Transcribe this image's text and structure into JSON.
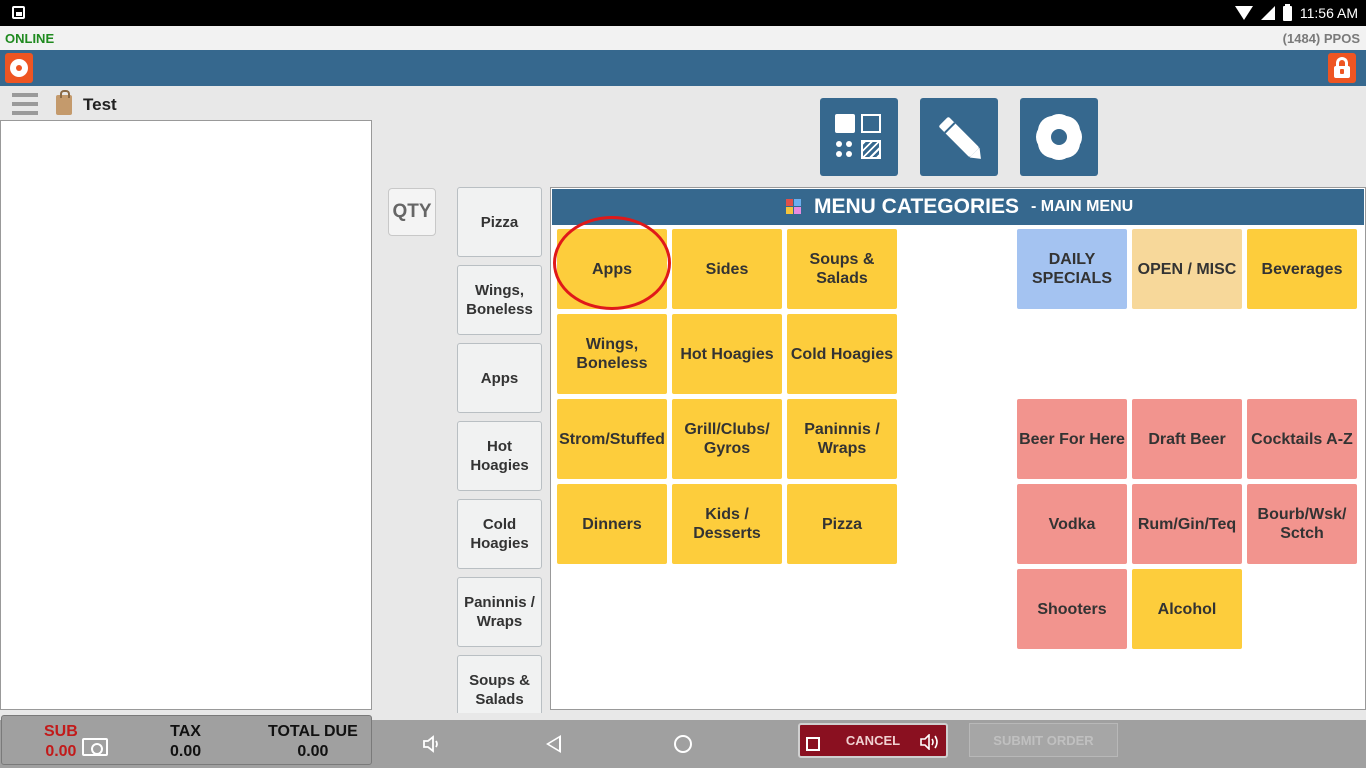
{
  "status_bar": {
    "time": "11:56 AM"
  },
  "top_bar": {
    "status": "ONLINE",
    "terminal": "(1484) PPOS"
  },
  "order": {
    "name": "Test"
  },
  "qty_label": "QTY",
  "side_categories": [
    "Pizza",
    "Wings, Boneless",
    "Apps",
    "Hot Hoagies",
    "Cold Hoagies",
    "Paninnis / Wraps",
    "Soups & Salads"
  ],
  "menu": {
    "title": "MENU CATEGORIES",
    "subtitle": "- MAIN MENU",
    "tiles": [
      {
        "label": "Apps",
        "color": "#fdcd3c"
      },
      {
        "label": "Sides",
        "color": "#fdcd3c"
      },
      {
        "label": "Soups & Salads",
        "color": "#fdcd3c"
      },
      {
        "label": "DAILY SPECIALS",
        "color": "#a4c3f1"
      },
      {
        "label": "OPEN / MISC",
        "color": "#f7d89a"
      },
      {
        "label": "Beverages",
        "color": "#fdcd3c"
      },
      {
        "label": "Wings, Boneless",
        "color": "#fdcd3c"
      },
      {
        "label": "Hot Hoagies",
        "color": "#fdcd3c"
      },
      {
        "label": "Cold Hoagies",
        "color": "#fdcd3c"
      },
      {
        "label": "Strom/Stuffed",
        "color": "#fdcd3c"
      },
      {
        "label": "Grill/Clubs/ Gyros",
        "color": "#fdcd3c"
      },
      {
        "label": "Paninnis / Wraps",
        "color": "#fdcd3c"
      },
      {
        "label": "Beer For Here",
        "color": "#f2948e"
      },
      {
        "label": "Draft Beer",
        "color": "#f2948e"
      },
      {
        "label": "Cocktails A-Z",
        "color": "#f2948e"
      },
      {
        "label": "Dinners",
        "color": "#fdcd3c"
      },
      {
        "label": "Kids / Desserts",
        "color": "#fdcd3c"
      },
      {
        "label": "Pizza",
        "color": "#fdcd3c"
      },
      {
        "label": "Vodka",
        "color": "#f2948e"
      },
      {
        "label": "Rum/Gin/Teq",
        "color": "#f2948e"
      },
      {
        "label": "Bourb/Wsk/ Sctch",
        "color": "#f2948e"
      },
      {
        "label": "Shooters",
        "color": "#f2948e"
      },
      {
        "label": "Alcohol",
        "color": "#fdcd3c"
      }
    ]
  },
  "totals": {
    "sub_label": "SUB",
    "sub_value": "0.00",
    "tax_label": "TAX",
    "tax_value": "0.00",
    "due_label": "TOTAL DUE",
    "due_value": "0.00"
  },
  "buttons": {
    "cancel": "CANCEL",
    "submit": "SUBMIT ORDER"
  },
  "colors": {
    "header_blue": "#36688e",
    "accent_orange": "#ee5522",
    "online_green": "#1f8a1f",
    "highlight_red": "#e01919"
  }
}
